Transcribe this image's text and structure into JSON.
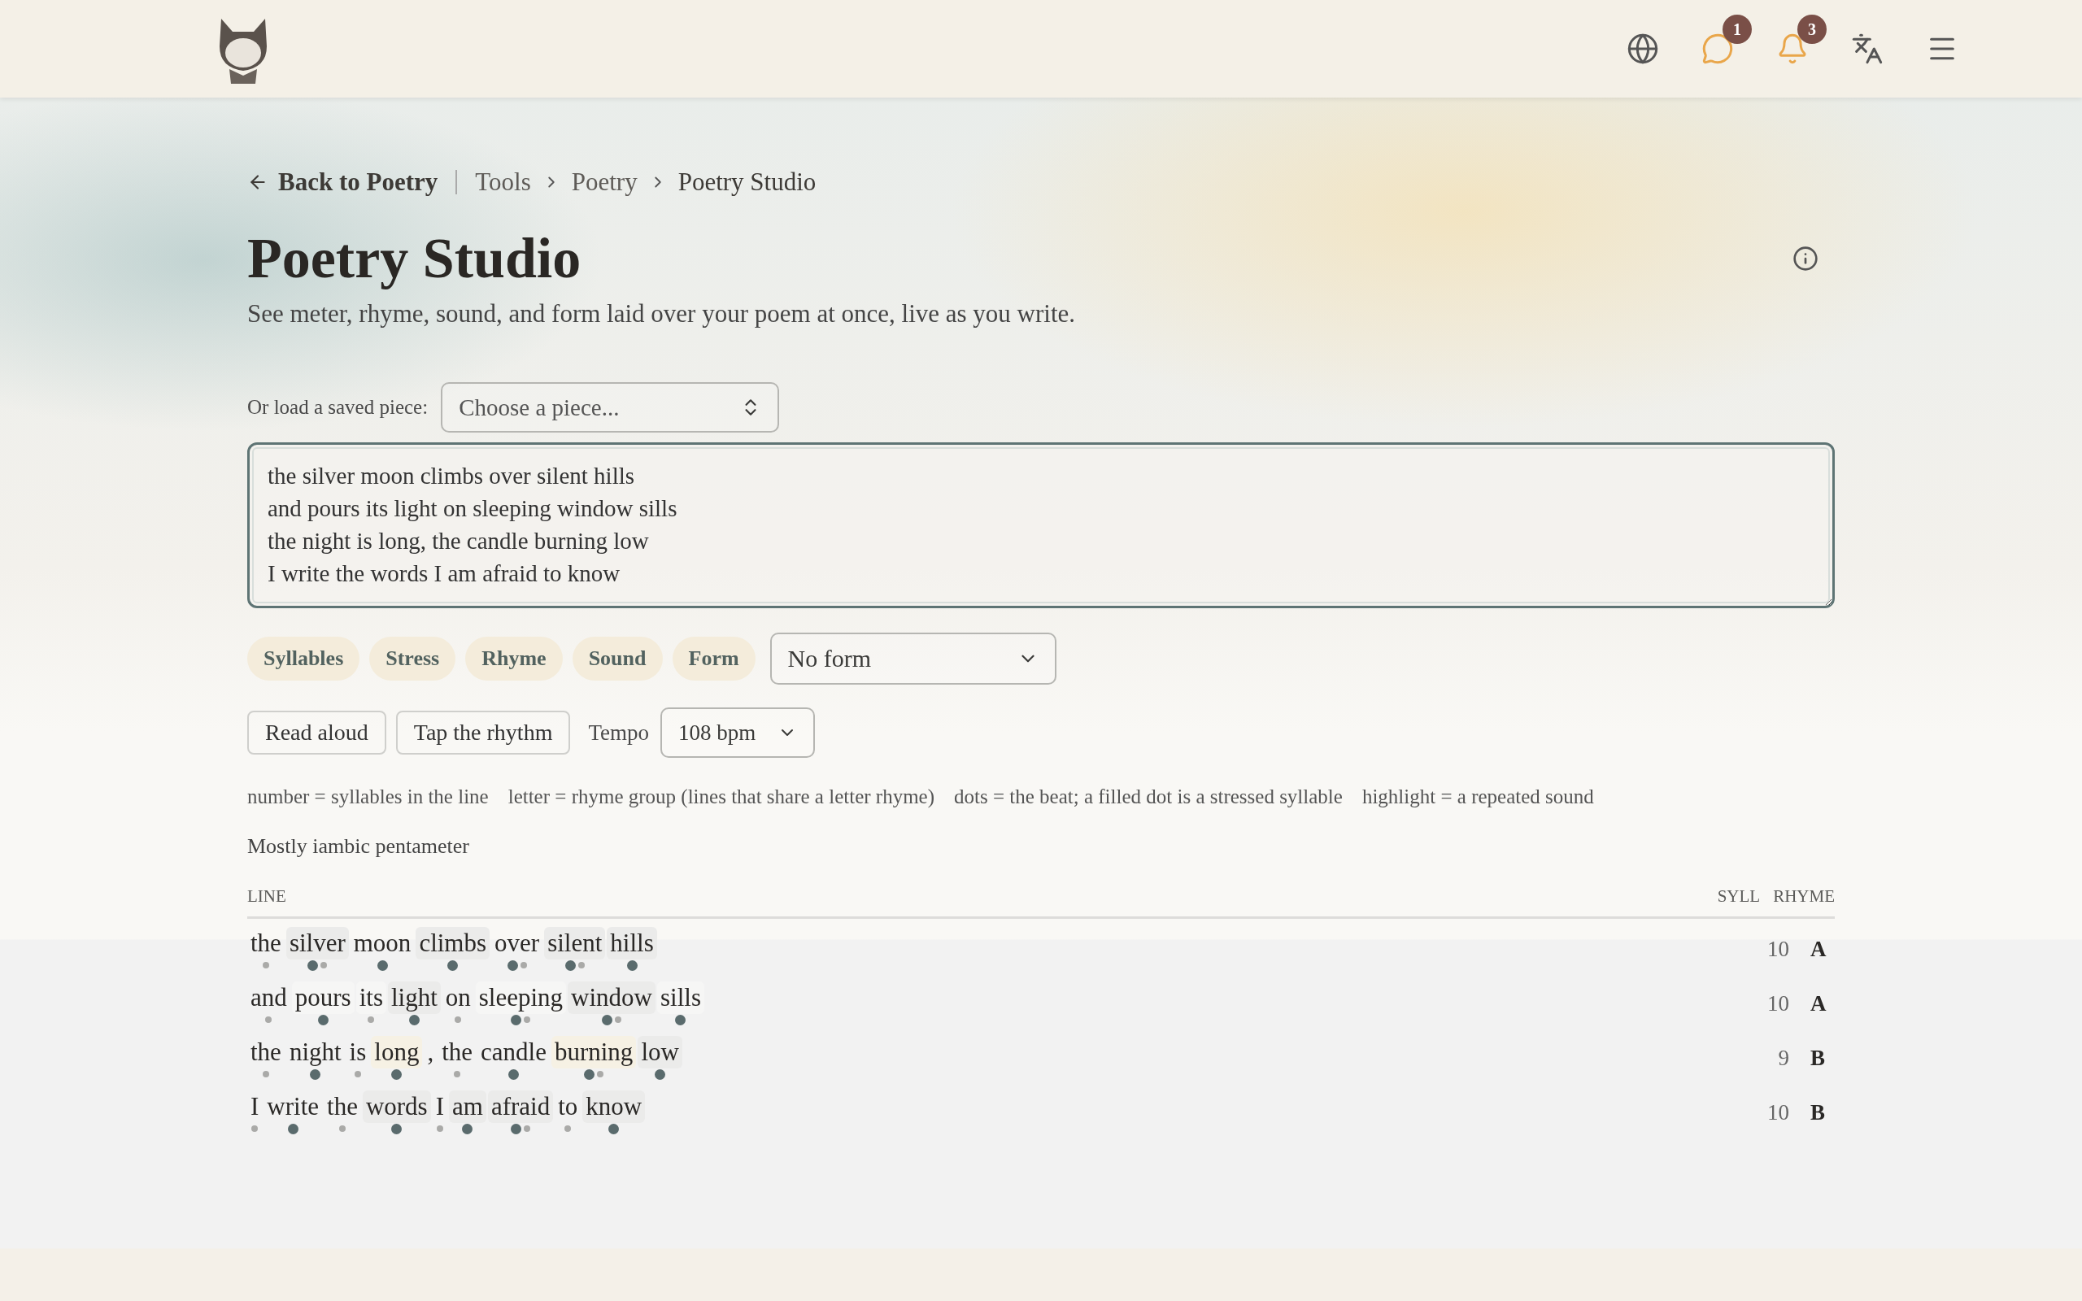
{
  "header": {
    "badges": [
      {
        "count": "1"
      },
      {
        "count": "3"
      }
    ]
  },
  "breadcrumb": {
    "back": "Back to Poetry",
    "items": [
      "Tools",
      "Poetry",
      "Poetry Studio"
    ]
  },
  "title": "Poetry Studio",
  "subtitle": "See meter, rhyme, sound, and form laid over your poem at once, live as you write.",
  "load": {
    "label": "Or load a saved piece:",
    "placeholder": "Choose a piece..."
  },
  "poem": {
    "value": "the silver moon climbs over silent hills\nand pours its light on sleeping window sills\nthe night is long, the candle burning low\nI write the words I am afraid to know"
  },
  "toggles": [
    {
      "label": "Syllables",
      "on": true
    },
    {
      "label": "Stress",
      "on": true
    },
    {
      "label": "Rhyme",
      "on": true
    },
    {
      "label": "Sound",
      "on": true
    },
    {
      "label": "Form",
      "on": true
    }
  ],
  "form_select": {
    "value": "No form"
  },
  "buttons": [
    "Read aloud",
    "Tap the rhythm"
  ],
  "tempo": {
    "label": "Tempo",
    "value": "108 bpm"
  },
  "legend": [
    "number = syllables in the line",
    "letter = rhyme group (lines that share a letter rhyme)",
    "dots = the beat; a filled dot is a stressed syllable",
    "highlight = a repeated sound"
  ],
  "meter": "Mostly iambic pentameter",
  "table": {
    "columns": [
      "LINE",
      "SYLL",
      "RHYME"
    ],
    "rows": [
      {
        "syll": "10",
        "rhyme": "A",
        "words": [
          {
            "text": "the",
            "highlighted": false,
            "stress": [
              false
            ]
          },
          {
            "text": "silver",
            "highlighted": true,
            "color": "#ebebea",
            "stress": [
              true,
              false
            ]
          },
          {
            "text": "moon",
            "highlighted": false,
            "stress": [
              true
            ]
          },
          {
            "text": "climbs",
            "highlighted": true,
            "color": "#ebebea",
            "stress": [
              true
            ]
          },
          {
            "text": "over",
            "highlighted": false,
            "stress": [
              true,
              false
            ]
          },
          {
            "text": "silent",
            "highlighted": true,
            "color": "#ebebea",
            "stress": [
              true,
              false
            ]
          },
          {
            "text": "hills",
            "highlighted": true,
            "color": "#ebebea",
            "stress": [
              true
            ]
          }
        ]
      },
      {
        "syll": "10",
        "rhyme": "A",
        "words": [
          {
            "text": "and",
            "highlighted": false,
            "stress": [
              false
            ]
          },
          {
            "text": "pours",
            "highlighted": true,
            "color": "#f6f6f5",
            "stress": [
              true
            ]
          },
          {
            "text": "its",
            "highlighted": true,
            "color": "#f6f6f5",
            "stress": [
              false
            ]
          },
          {
            "text": "light",
            "highlighted": true,
            "color": "#ebebea",
            "stress": [
              true
            ]
          },
          {
            "text": "on",
            "highlighted": false,
            "stress": [
              false
            ]
          },
          {
            "text": "sleeping",
            "highlighted": true,
            "color": "#f6f6f5",
            "stress": [
              true,
              false
            ]
          },
          {
            "text": "window",
            "highlighted": true,
            "color": "#ebebea",
            "stress": [
              true,
              false
            ]
          },
          {
            "text": "sills",
            "highlighted": true,
            "color": "#f6f6f5",
            "stress": [
              true
            ]
          }
        ]
      },
      {
        "syll": "9",
        "rhyme": "B",
        "words": [
          {
            "text": "the",
            "highlighted": false,
            "stress": [
              false
            ]
          },
          {
            "text": "night",
            "highlighted": false,
            "stress": [
              true
            ]
          },
          {
            "text": "is",
            "highlighted": false,
            "stress": [
              false
            ]
          },
          {
            "text": "long",
            "highlighted": true,
            "color": "#f6f1e4",
            "stress": [
              true
            ]
          },
          {
            "text": ",",
            "highlighted": false
          },
          {
            "text": "the",
            "highlighted": false,
            "stress": [
              false
            ]
          },
          {
            "text": "candle",
            "highlighted": false,
            "stress": [
              true
            ]
          },
          {
            "text": "burning",
            "highlighted": true,
            "color": "#f6f1e4",
            "stress": [
              true,
              false
            ]
          },
          {
            "text": "low",
            "highlighted": true,
            "color": "#ebebea",
            "stress": [
              true
            ]
          }
        ]
      },
      {
        "syll": "10",
        "rhyme": "B",
        "words": [
          {
            "text": "I",
            "highlighted": false,
            "stress": [
              false
            ]
          },
          {
            "text": "write",
            "highlighted": false,
            "stress": [
              true
            ]
          },
          {
            "text": "the",
            "highlighted": false,
            "stress": [
              false
            ]
          },
          {
            "text": "words",
            "highlighted": true,
            "color": "#ebebea",
            "stress": [
              true
            ]
          },
          {
            "text": "I",
            "highlighted": false,
            "stress": [
              false
            ]
          },
          {
            "text": "am",
            "highlighted": true,
            "color": "#ebebea",
            "stress": [
              true
            ]
          },
          {
            "text": "afraid",
            "highlighted": true,
            "color": "#ebebea",
            "stress": [
              true,
              false
            ]
          },
          {
            "text": "to",
            "highlighted": false,
            "stress": [
              false
            ]
          },
          {
            "text": "know",
            "highlighted": true,
            "color": "#ebebea",
            "stress": [
              true
            ]
          }
        ]
      }
    ]
  }
}
